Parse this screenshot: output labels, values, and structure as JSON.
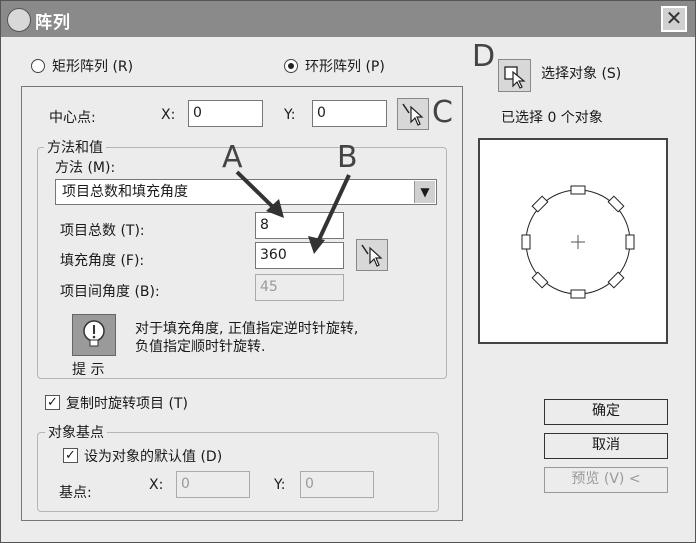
{
  "window": {
    "title": "阵列"
  },
  "type_options": [
    {
      "label": "矩形阵列 (R)",
      "selected": false
    },
    {
      "label": "环形阵列 (P)",
      "selected": true
    }
  ],
  "center_point": {
    "label": "中心点:",
    "x_label": "X:",
    "x_value": "0",
    "y_label": "Y:",
    "y_value": "0"
  },
  "method": {
    "group_title": "方法和值",
    "label": "方法 (M):",
    "selected": "项目总数和填充角度",
    "items_total_label": "项目总数 (T):",
    "items_total_value": "8",
    "fill_angle_label": "填充角度 (F):",
    "fill_angle_value": "360",
    "between_angle_label": "项目间角度 (B):",
    "between_angle_value": "45"
  },
  "tip": {
    "label": "提 示",
    "line1": "对于填充角度, 正值指定逆时针旋转,",
    "line2": "负值指定顺时针旋转."
  },
  "rotate_items": {
    "label": "复制时旋转项目 (T)",
    "checked": true
  },
  "base_point": {
    "group_title": "对象基点",
    "default_label": "设为对象的默认值 (D)",
    "default_checked": true,
    "label": "基点:",
    "x_label": "X:",
    "x_value": "0",
    "y_label": "Y:",
    "y_value": "0"
  },
  "select_objects": {
    "label": "选择对象 (S)",
    "status": "已选择  0  个对象"
  },
  "buttons": {
    "ok": "确定",
    "cancel": "取消",
    "preview": "预览 (V) <"
  },
  "annotations": {
    "a": "A",
    "b": "B",
    "c": "C",
    "d": "D"
  }
}
